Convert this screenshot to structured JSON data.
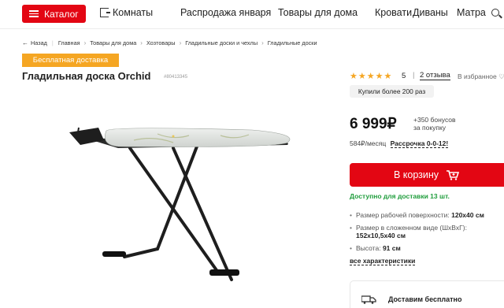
{
  "header": {
    "catalog_label": "Каталог",
    "rooms_label": "Комнаты",
    "nav": [
      "Распродажа января",
      "Товары для дома",
      "Кровати",
      "Диваны",
      "Матра"
    ]
  },
  "breadcrumb": {
    "back": "Назад",
    "items": [
      "Главная",
      "Товары для дома",
      "Хозтовары",
      "Гладильные доски и чехлы",
      "Гладильные доски"
    ]
  },
  "product": {
    "badge": "Бесплатная доставка",
    "title": "Гладильная доска Orchid",
    "sku": "#80413345"
  },
  "rating": {
    "stars": 5,
    "value": "5",
    "reviews": "2 отзыва",
    "favorites": "В избранное"
  },
  "bought_label": "Купили более 200 раз",
  "price": {
    "value": "6 999₽",
    "bonus_line1": "+350 бонусов",
    "bonus_line2": "за покупку",
    "monthly": "584₽/месяц",
    "installment": "Рассрочка 0-0-12!"
  },
  "cart": {
    "label": "В корзину"
  },
  "availability": "Доступно для доставки 13 шт.",
  "specs": [
    {
      "label": "Размер рабочей поверхности:",
      "value": "120x40 см"
    },
    {
      "label": "Размер в сложенном виде (ШхВхГ):",
      "value": "152x10,5x40 см"
    },
    {
      "label": "Высота:",
      "value": "91 см"
    }
  ],
  "all_specs": "все характеристики",
  "delivery": "Доставим бесплатно",
  "colors": {
    "brand_red": "#e30613",
    "badge_orange": "#f5a623",
    "available_green": "#1f9d3c"
  }
}
